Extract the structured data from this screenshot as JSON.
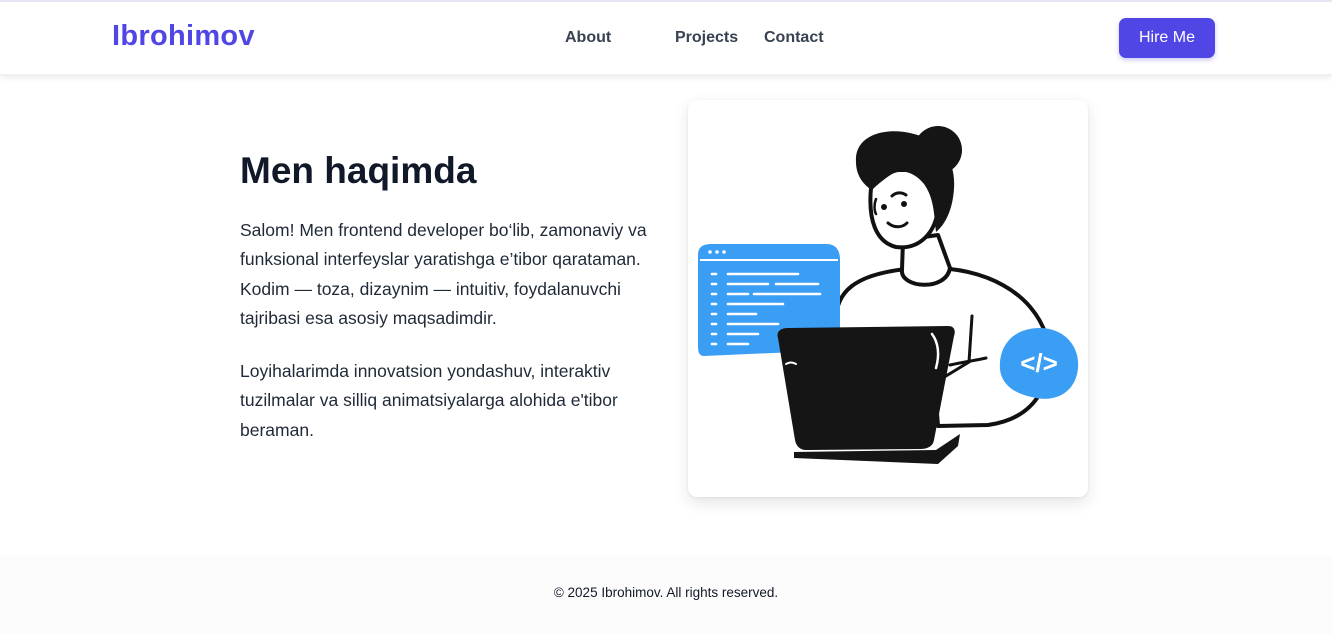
{
  "header": {
    "logo": "Ibrohimov",
    "nav": [
      {
        "label": "About"
      },
      {
        "label": "Projects"
      },
      {
        "label": "Contact"
      }
    ],
    "cta_label": "Hire Me"
  },
  "about": {
    "title": "Men haqimda",
    "paragraphs": [
      "Salom! Men frontend developer bo‘lib, zamonaviy va funksional interfeyslar yaratishga e’tibor qarataman. Kodim — toza, dizaynim — intuitiv, foydalanuvchi tajribasi esa asosiy maqsadimdir.",
      "Loyihalarimda innovatsion yondashuv, interaktiv tuzilmalar va silliq animatsiyalarga alohida e'tibor beraman."
    ],
    "illustration": {
      "icon": "developer-with-laptop-illustration",
      "code_badge": "</>"
    }
  },
  "footer": {
    "text": "© 2025 Ibrohimov. All rights reserved."
  },
  "colors": {
    "brand": "#4f46e5",
    "illustration_accent": "#3b9ef5",
    "illustration_ink": "#111111"
  }
}
